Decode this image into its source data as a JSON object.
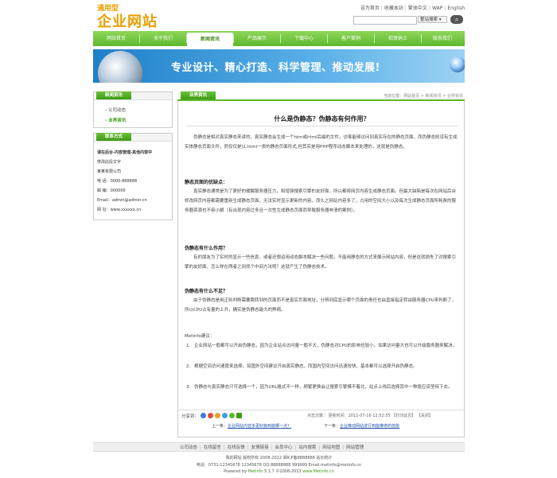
{
  "header": {
    "logo_line1": "通用型",
    "logo_line2": "企业网站",
    "top_links": [
      "设为首页",
      "收藏本站",
      "繁体中文",
      "WAP",
      "English"
    ],
    "search_select": "整站搜索",
    "search_button_icon": "search-icon"
  },
  "nav": {
    "items": [
      {
        "label": "网站首页"
      },
      {
        "label": "关于我们"
      },
      {
        "label": "新闻资讯"
      },
      {
        "label": "产品展示"
      },
      {
        "label": "下载中心"
      },
      {
        "label": "客户案例"
      },
      {
        "label": "招贤纳士"
      },
      {
        "label": "联系我们"
      }
    ],
    "active_index": 2
  },
  "banner": {
    "text": "专业设计、精心打造、科学管理、推动发展!"
  },
  "sidebar": {
    "news_title": "新闻资讯",
    "news_items": [
      {
        "label": "公司动态"
      },
      {
        "label": "业界资讯"
      }
    ],
    "contact_title": "联系方式",
    "contact_lines": [
      "请在后台-内容管理-其他内容中",
      "修改此段文字",
      "某某有限公司",
      "电 话：0000-888888",
      "邮 编：000000",
      "Email：admin@admin.cn",
      "网 址：www.xxxxxx.cn"
    ]
  },
  "main": {
    "tab_title": "业界资讯",
    "breadcrumb": "当前位置：网站首页 > 新闻资讯 > 业界资讯",
    "article_title": "什么是伪静态？伪静态有何作用？",
    "intro": "伪静态是相对真实静态来讲的，真实静态会生成一个htm或html后缀的文件，访客能够访问到真实存在的静态页面，而伪静态则没有生成实体静态页面文件，而仅仅是以.html一类的静态页面形式,但其实是用PHP程序动态脚本来处理的，这就是伪静态。",
    "sections": [
      {
        "heading": "静态页面的优缺点：",
        "body": "真实静态通常是为了更好的缓解服务器压力，和增强搜索引擎的友好面，所以都将网页内容生成静态页面。但最大缺陷是每次在网站后台修改网页内容都需要重新生成静态页面，无法实时显示更新的内容，而久之网站内容多了，占用的空间大小以及每次生成静态页面所耗费的服务器资源也不容小觑（有出现内容过多且一次性生成静态页面而导致服务器奔溃的案例）。"
      },
      {
        "heading": "伪静态有什么作用？",
        "body": "有的朋友为了实时的显示一些信息，或者还想运用动态脚本解决一些问题，不能用静态的方式来展示网站内容，但是这就损失了对搜索引擎的友好面，怎么样在两者之间找个中间方法呢？这就产生了伪静态技术。"
      },
      {
        "heading": "伪静态有什么不足？",
        "body": "由于伪静态是用正则判断需要跳转到的页面而不是真实页面地址，分辨到底显示哪个页面的责任也由直接指定转由服务器CPU来判断了，所以CPU占有量的上升，确实是伪静态最大的弊病。"
      }
    ],
    "advice_label": "MetInfo建议：",
    "advice": [
      "企业网站一般都可以开启伪静态，因为企业站点访问量一般不大，伪静态对CPU的影响也较小，如果访问量大也可以升级服务器来解决。",
      "根据空间访问速度来选择，如国外空间建议开启真实静态，而国内空间访问迅速较快，基本都可以选择开启伪静态。",
      "伪静态与真实静态只可选择一个，因为URL格式不一样，频繁更换会让搜索引擎摸不着北，站点上线后选择其中一种既应该坚持下去。"
    ],
    "share_label": "分享到：",
    "share_icons": [
      "share-icon-1",
      "share-icon-2",
      "share-icon-3",
      "share-icon-4",
      "share-icon-5",
      "share-icon-6"
    ],
    "meta": "点击次数：    更新时间：2012-07-16 12:52:55  【打印此页】 【关闭】",
    "prev_label": "上一条：",
    "prev_link": "企业网站内容多更好篇到底哪一点？",
    "next_label": "下一条：",
    "next_link": "企业推动网站进行到能推修的技能",
    "colors": {
      "accent": "#5cb82c",
      "link": "#2255aa"
    }
  },
  "footer": {
    "links": [
      "公司动态",
      "在线留言",
      "在线反馈",
      "友情链接",
      "会员中心",
      "站内搜索",
      "网站地图",
      "网站管理"
    ],
    "line1": "我的网站 版权所有 2008-2012 湘ICP备8888888 站长统计",
    "line2": "电话：0731-12345678 12345678  QQ:88888888 999999  Email:metinfo@metinfo.cn",
    "line3_prefix": "Powered by",
    "line3_brand": "MetInfo",
    "line3_suffix": "5.1.7 ©2008-2013",
    "line3_site": "www.MetInfo.cn"
  }
}
